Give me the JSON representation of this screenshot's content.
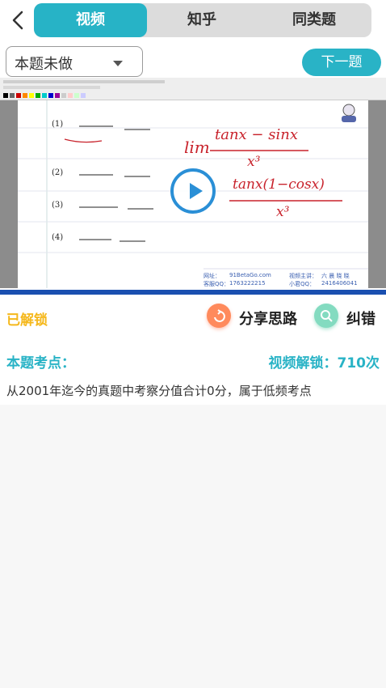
{
  "tabs": [
    {
      "label": "视频",
      "active": true
    },
    {
      "label": "知乎",
      "active": false
    },
    {
      "label": "同类题",
      "active": false
    }
  ],
  "status_select": {
    "value": "本题未做"
  },
  "next_button": {
    "label": "下一题"
  },
  "video": {
    "problems": [
      "(1)",
      "(2)",
      "(3)",
      "(4)"
    ],
    "handwriting": [
      "lim",
      "tanx − sinx",
      "x³",
      "tanx(1−cosx)",
      "x³"
    ],
    "footer": [
      "网址：",
      "91BetaGo.com",
      "视频主讲：",
      "六 晨 晓 晓",
      "客服QQ：",
      "1763222215",
      "小君QQ：",
      "2416406041"
    ],
    "progress": 1.0
  },
  "actions": {
    "unlocked": "已解锁",
    "share": "分享思路",
    "correct": "纠错"
  },
  "detail": {
    "title": "本题考点：",
    "unlock_count": "视频解锁：710次",
    "description": "从2001年迄今的真题中考察分值合计0分，属于低频考点"
  },
  "colors": {
    "accent": "#29b3c6",
    "unlocked": "#f5b81c",
    "share": "#ff8a5c",
    "correct": "#83dbc0",
    "ink": "#c8222b"
  }
}
